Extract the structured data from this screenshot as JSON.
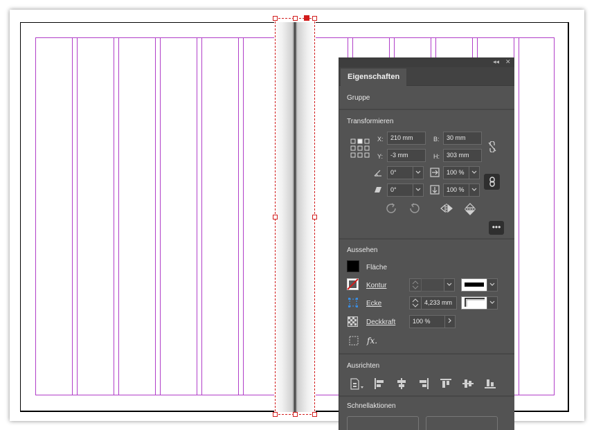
{
  "panel": {
    "tab_label": "Eigenschaften",
    "collapse_icon": "double-chevron-left",
    "close_icon": "close-x",
    "section_object": "Gruppe",
    "transform": {
      "title": "Transformieren",
      "x_label": "X:",
      "x_value": "210 mm",
      "y_label": "Y:",
      "y_value": "-3 mm",
      "w_label": "B:",
      "w_value": "30 mm",
      "h_label": "H:",
      "h_value": "303 mm",
      "rotation_value": "0°",
      "scale_x_value": "100 %",
      "shear_value": "0°",
      "scale_y_value": "100 %"
    },
    "appearance": {
      "title": "Aussehen",
      "fill_label": "Fläche",
      "stroke_label": "Kontur",
      "corner_label": "Ecke",
      "corner_value": "4,233 mm",
      "opacity_label": "Deckkraft",
      "opacity_value": "100 %",
      "fx_label": "fx."
    },
    "align": {
      "title": "Ausrichten"
    },
    "quick_actions": {
      "title": "Schnellaktionen"
    }
  },
  "colors": {
    "panel_bg": "#535353",
    "guide_magenta": "#b03dc8",
    "selection_red": "#d21c1c"
  }
}
